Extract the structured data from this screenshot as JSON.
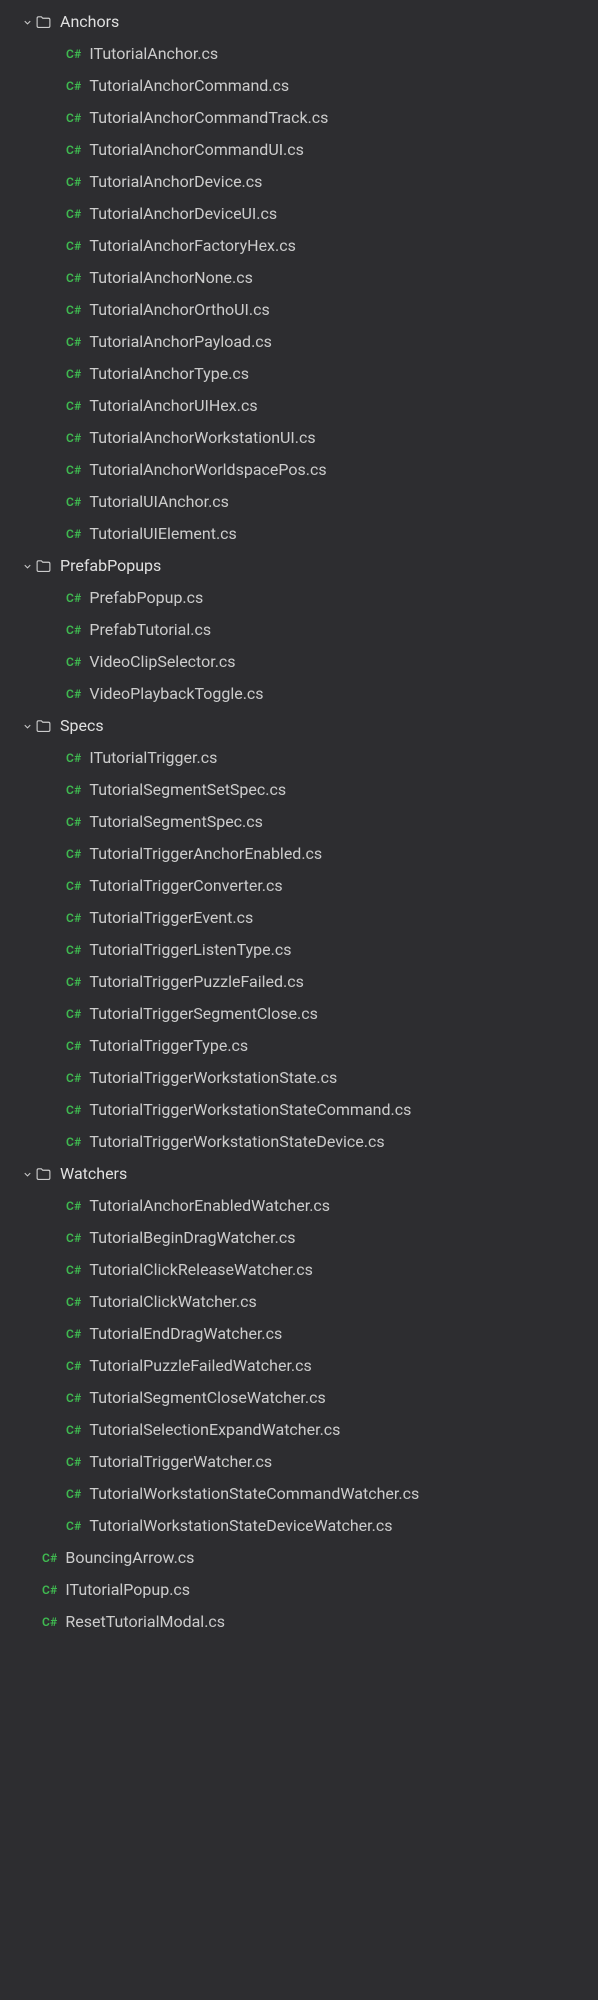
{
  "icons": {
    "cs_badge": "C#"
  },
  "tree": {
    "indent_base": 20,
    "indent_step": 24,
    "nodes": [
      {
        "type": "folder",
        "name": "Anchors",
        "depth": 0,
        "expanded": true
      },
      {
        "type": "file",
        "name": "ITutorialAnchor.cs",
        "depth": 1
      },
      {
        "type": "file",
        "name": "TutorialAnchorCommand.cs",
        "depth": 1
      },
      {
        "type": "file",
        "name": "TutorialAnchorCommandTrack.cs",
        "depth": 1
      },
      {
        "type": "file",
        "name": "TutorialAnchorCommandUI.cs",
        "depth": 1
      },
      {
        "type": "file",
        "name": "TutorialAnchorDevice.cs",
        "depth": 1
      },
      {
        "type": "file",
        "name": "TutorialAnchorDeviceUI.cs",
        "depth": 1
      },
      {
        "type": "file",
        "name": "TutorialAnchorFactoryHex.cs",
        "depth": 1
      },
      {
        "type": "file",
        "name": "TutorialAnchorNone.cs",
        "depth": 1
      },
      {
        "type": "file",
        "name": "TutorialAnchorOrthoUI.cs",
        "depth": 1
      },
      {
        "type": "file",
        "name": "TutorialAnchorPayload.cs",
        "depth": 1
      },
      {
        "type": "file",
        "name": "TutorialAnchorType.cs",
        "depth": 1
      },
      {
        "type": "file",
        "name": "TutorialAnchorUIHex.cs",
        "depth": 1
      },
      {
        "type": "file",
        "name": "TutorialAnchorWorkstationUI.cs",
        "depth": 1
      },
      {
        "type": "file",
        "name": "TutorialAnchorWorldspacePos.cs",
        "depth": 1
      },
      {
        "type": "file",
        "name": "TutorialUIAnchor.cs",
        "depth": 1
      },
      {
        "type": "file",
        "name": "TutorialUIElement.cs",
        "depth": 1
      },
      {
        "type": "folder",
        "name": "PrefabPopups",
        "depth": 0,
        "expanded": true
      },
      {
        "type": "file",
        "name": "PrefabPopup.cs",
        "depth": 1
      },
      {
        "type": "file",
        "name": "PrefabTutorial.cs",
        "depth": 1
      },
      {
        "type": "file",
        "name": "VideoClipSelector.cs",
        "depth": 1
      },
      {
        "type": "file",
        "name": "VideoPlaybackToggle.cs",
        "depth": 1
      },
      {
        "type": "folder",
        "name": "Specs",
        "depth": 0,
        "expanded": true
      },
      {
        "type": "file",
        "name": "ITutorialTrigger.cs",
        "depth": 1
      },
      {
        "type": "file",
        "name": "TutorialSegmentSetSpec.cs",
        "depth": 1
      },
      {
        "type": "file",
        "name": "TutorialSegmentSpec.cs",
        "depth": 1
      },
      {
        "type": "file",
        "name": "TutorialTriggerAnchorEnabled.cs",
        "depth": 1
      },
      {
        "type": "file",
        "name": "TutorialTriggerConverter.cs",
        "depth": 1
      },
      {
        "type": "file",
        "name": "TutorialTriggerEvent.cs",
        "depth": 1
      },
      {
        "type": "file",
        "name": "TutorialTriggerListenType.cs",
        "depth": 1
      },
      {
        "type": "file",
        "name": "TutorialTriggerPuzzleFailed.cs",
        "depth": 1
      },
      {
        "type": "file",
        "name": "TutorialTriggerSegmentClose.cs",
        "depth": 1
      },
      {
        "type": "file",
        "name": "TutorialTriggerType.cs",
        "depth": 1
      },
      {
        "type": "file",
        "name": "TutorialTriggerWorkstationState.cs",
        "depth": 1
      },
      {
        "type": "file",
        "name": "TutorialTriggerWorkstationStateCommand.cs",
        "depth": 1
      },
      {
        "type": "file",
        "name": "TutorialTriggerWorkstationStateDevice.cs",
        "depth": 1
      },
      {
        "type": "folder",
        "name": "Watchers",
        "depth": 0,
        "expanded": true
      },
      {
        "type": "file",
        "name": "TutorialAnchorEnabledWatcher.cs",
        "depth": 1
      },
      {
        "type": "file",
        "name": "TutorialBeginDragWatcher.cs",
        "depth": 1
      },
      {
        "type": "file",
        "name": "TutorialClickReleaseWatcher.cs",
        "depth": 1
      },
      {
        "type": "file",
        "name": "TutorialClickWatcher.cs",
        "depth": 1
      },
      {
        "type": "file",
        "name": "TutorialEndDragWatcher.cs",
        "depth": 1
      },
      {
        "type": "file",
        "name": "TutorialPuzzleFailedWatcher.cs",
        "depth": 1
      },
      {
        "type": "file",
        "name": "TutorialSegmentCloseWatcher.cs",
        "depth": 1
      },
      {
        "type": "file",
        "name": "TutorialSelectionExpandWatcher.cs",
        "depth": 1
      },
      {
        "type": "file",
        "name": "TutorialTriggerWatcher.cs",
        "depth": 1
      },
      {
        "type": "file",
        "name": "TutorialWorkstationStateCommandWatcher.cs",
        "depth": 1
      },
      {
        "type": "file",
        "name": "TutorialWorkstationStateDeviceWatcher.cs",
        "depth": 1
      },
      {
        "type": "file",
        "name": "BouncingArrow.cs",
        "depth": 0
      },
      {
        "type": "file",
        "name": "ITutorialPopup.cs",
        "depth": 0
      },
      {
        "type": "file",
        "name": "ResetTutorialModal.cs",
        "depth": 0
      }
    ]
  }
}
